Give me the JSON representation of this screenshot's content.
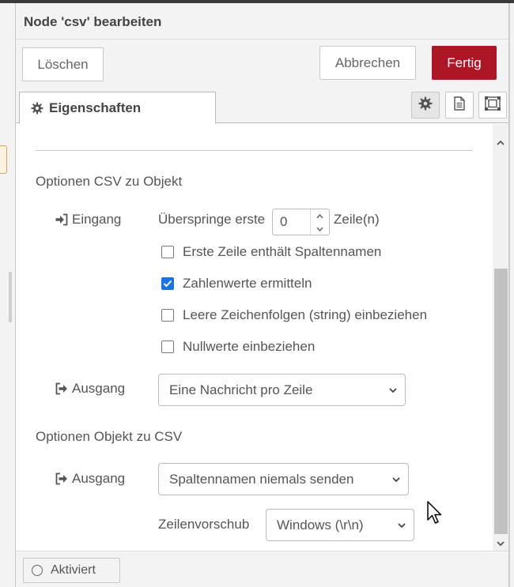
{
  "dialog": {
    "title": "Node 'csv' bearbeiten"
  },
  "toolbar": {
    "delete_label": "Löschen",
    "cancel_label": "Abbrechen",
    "done_label": "Fertig"
  },
  "tabs": {
    "properties_label": "Eigenschaften",
    "icons": [
      "gear-icon",
      "document-icon",
      "frame-icon"
    ]
  },
  "csv_to_object": {
    "heading": "Optionen CSV zu Objekt",
    "input_label": "Eingang",
    "skip_prefix": "Überspringe erste",
    "skip_value": "0",
    "skip_suffix": "Zeile(n)",
    "checkboxes": [
      {
        "label": "Erste Zeile enthält Spaltennamen",
        "checked": false
      },
      {
        "label": "Zahlenwerte ermitteln",
        "checked": true
      },
      {
        "label": "Leere Zeichenfolgen (string) einbeziehen",
        "checked": false
      },
      {
        "label": "Nullwerte einbeziehen",
        "checked": false
      }
    ],
    "output_label": "Ausgang",
    "output_value": "Eine Nachricht pro Zeile"
  },
  "object_to_csv": {
    "heading": "Optionen Objekt zu CSV",
    "output_label": "Ausgang",
    "output_value": "Spaltennamen niemals senden",
    "newline_label": "Zeilenvorschub",
    "newline_value": "Windows (\\r\\n)"
  },
  "footer": {
    "enabled_label": "Aktiviert"
  },
  "colors": {
    "accent": "#ad1625",
    "checkbox": "#1a73e8"
  }
}
